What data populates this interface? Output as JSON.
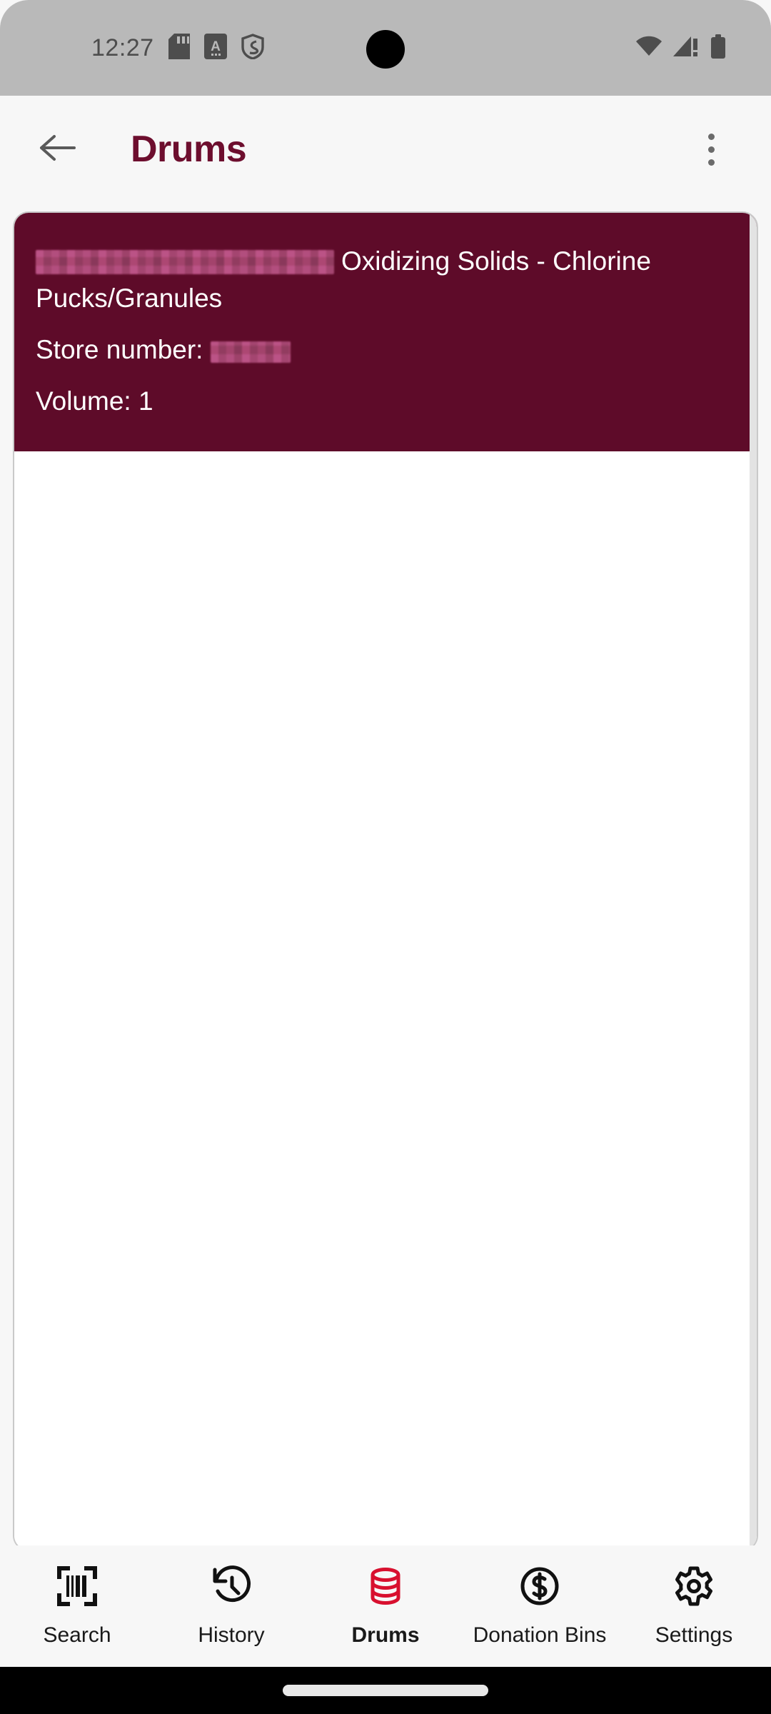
{
  "statusbar": {
    "time": "12:27",
    "icons_left": [
      "sd-card-icon",
      "a-badge-icon",
      "shield-icon"
    ],
    "icons_right": [
      "wifi-icon",
      "cellular-signal-warning-icon",
      "battery-icon"
    ]
  },
  "appbar": {
    "back_icon": "back-arrow-icon",
    "title": "Drums",
    "overflow_icon": "overflow-menu-icon",
    "title_color": "#6d0e2e"
  },
  "drum_entry": {
    "timestamp_redacted": "",
    "material": "Oxidizing Solids - Chlorine Pucks/Granules",
    "store_number_label": "Store number:",
    "store_number_redacted": "",
    "volume_text": "Volume: 1",
    "background_color": "#5e0b29"
  },
  "bottomnav": {
    "items": [
      {
        "label": "Search",
        "icon": "barcode-scan-icon",
        "active": false
      },
      {
        "label": "History",
        "icon": "history-clock-icon",
        "active": false
      },
      {
        "label": "Drums",
        "icon": "database-drum-icon",
        "active": true
      },
      {
        "label": "Donation Bins",
        "icon": "dollar-circle-icon",
        "active": false
      },
      {
        "label": "Settings",
        "icon": "gear-icon",
        "active": false
      }
    ],
    "active_color": "#d8102f"
  }
}
